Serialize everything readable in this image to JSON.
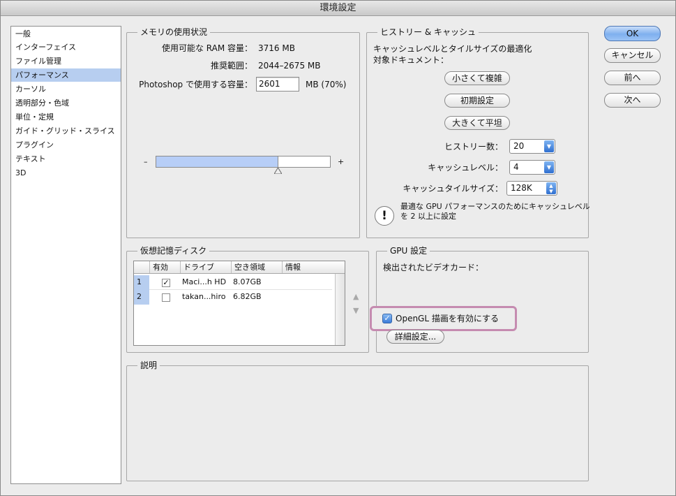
{
  "window": {
    "title": "環境設定"
  },
  "sidebar": {
    "items": [
      {
        "label": "一般"
      },
      {
        "label": "インターフェイス"
      },
      {
        "label": "ファイル管理"
      },
      {
        "label": "パフォーマンス",
        "selected": true
      },
      {
        "label": "カーソル"
      },
      {
        "label": "透明部分・色域"
      },
      {
        "label": "単位・定規"
      },
      {
        "label": "ガイド・グリッド・スライス"
      },
      {
        "label": "プラグイン"
      },
      {
        "label": "テキスト"
      },
      {
        "label": "3D"
      }
    ]
  },
  "memory": {
    "title": "メモリの使用状況",
    "available_label": "使用可能な RAM 容量：",
    "available_value": "3716 MB",
    "range_label": "推奨範囲：",
    "range_value": "2044–2675 MB",
    "use_label": "Photoshop で使用する容量：",
    "use_value": "2601",
    "use_unit": "MB (70%)",
    "slider_minus": "–",
    "slider_plus": "+",
    "slider_percent": 70
  },
  "history": {
    "title": "ヒストリー & キャッシュ",
    "optimize_line1": "キャッシュレベルとタイルサイズの最適化",
    "optimize_line2": "対象ドキュメント：",
    "btn_small": "小さくて複雑",
    "btn_default": "初期設定",
    "btn_large": "大きくて平坦",
    "history_label": "ヒストリー数：",
    "history_value": "20",
    "cache_label": "キャッシュレベル：",
    "cache_value": "4",
    "tile_label": "キャッシュタイルサイズ：",
    "tile_value": "128K",
    "note_line1": "最適な GPU パフォーマンスのためにキャッシュレベル",
    "note_line2": "を 2 以上に設定"
  },
  "scratch": {
    "title": "仮想記憶ディスク",
    "columns": [
      "有効",
      "ドライブ",
      "空き領域",
      "情報"
    ],
    "rows": [
      {
        "num": "1",
        "enabled": true,
        "drive": "Maci...h HD",
        "free": "8.07GB",
        "info": ""
      },
      {
        "num": "2",
        "enabled": false,
        "drive": "takan...hiro",
        "free": "6.82GB",
        "info": ""
      }
    ]
  },
  "gpu": {
    "title": "GPU 設定",
    "detected_label": "検出されたビデオカード：",
    "opengl_label": "OpenGL 描画を有効にする",
    "opengl_checked": true,
    "advanced_button": "詳細設定..."
  },
  "description": {
    "title": "説明"
  },
  "buttons": {
    "ok": "OK",
    "cancel": "キャンセル",
    "prev": "前へ",
    "next": "次へ"
  },
  "colors": {
    "selection": "#b7cef0",
    "highlight_border": "#c58bb0",
    "default_button": "#7fb0ef"
  }
}
